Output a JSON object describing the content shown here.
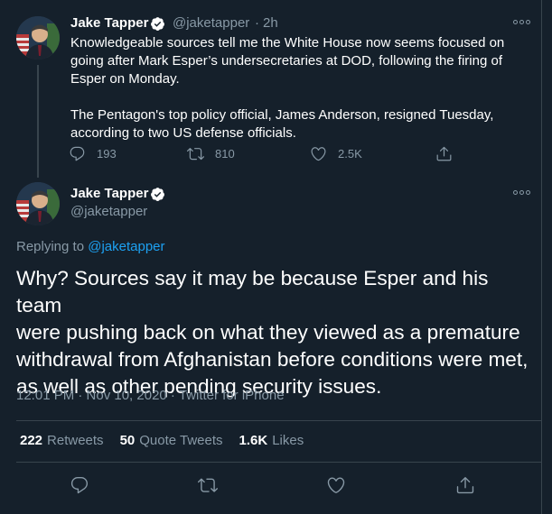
{
  "tweet1": {
    "name": "Jake Tapper",
    "handle": "@jaketapper",
    "separator": "·",
    "time": "2h",
    "text_line1": "Knowledgeable sources tell me the White House now seems focused on",
    "text_line2": "going after Mark Esper’s undersecretaries at DOD, following the firing of",
    "text_line3": "Esper on Monday.",
    "text_line4": "The Pentagon's top policy official, James Anderson, resigned Tuesday,",
    "text_line5": "according to two US defense officials.",
    "replies": "193",
    "retweets": "810",
    "likes": "2.5K"
  },
  "tweet2": {
    "name": "Jake Tapper",
    "handle": "@jaketapper",
    "replying_prefix": "Replying to",
    "replying_handle": "@jaketapper",
    "text_line1": "Why? Sources say it may be because Esper and his team",
    "text_line2": "were pushing back on what they viewed as a premature",
    "text_line3": "withdrawal from Afghanistan before conditions were met,",
    "text_line4": "as well as other pending security issues.",
    "meta": "12:01 PM · Nov 10, 2020 · Twitter for iPhone",
    "retweets_count": "222",
    "retweets_label": "Retweets",
    "quotes_count": "50",
    "quotes_label": "Quote Tweets",
    "likes_count": "1.6K",
    "likes_label": "Likes"
  },
  "colors": {
    "background": "#15202b",
    "secondary_text": "#8899a6",
    "accent": "#1da1f2",
    "divider": "#38444d"
  },
  "icons": [
    "reply-icon",
    "retweet-icon",
    "like-icon",
    "share-icon",
    "verified-badge-icon",
    "more-options-icon"
  ]
}
